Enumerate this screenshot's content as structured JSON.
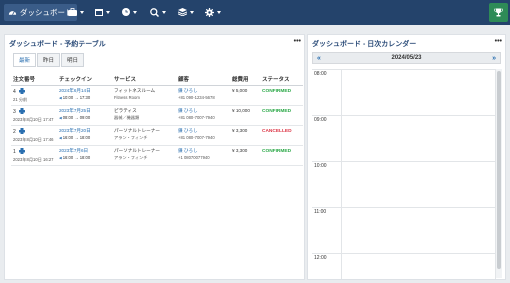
{
  "nav": {
    "brand": "ダッシュボード",
    "items": [
      {
        "icon": "briefcase-icon"
      },
      {
        "icon": "calendar-icon"
      },
      {
        "icon": "clock-icon"
      },
      {
        "icon": "zoom-icon"
      },
      {
        "icon": "layers-icon"
      },
      {
        "icon": "gear-icon"
      }
    ],
    "trophy_icon": "trophy-icon"
  },
  "left_panel": {
    "title": "ダッシュボード - 予約テーブル",
    "menu": "•••",
    "tabs": [
      {
        "label": "最新",
        "active": true
      },
      {
        "label": "昨日",
        "active": false
      },
      {
        "label": "明日",
        "active": false
      }
    ],
    "columns": [
      "注文番号",
      "チェックイン",
      "サービス",
      "顧客",
      "総費用",
      "ステータス"
    ],
    "rows": [
      {
        "id": "4",
        "sub": "21 分前",
        "date": "2024年6月14日",
        "time": "10:00 → 17:30",
        "service": "フィットネスルーム",
        "service_sub": "Fitness Room",
        "customer": "鎌 ひろし",
        "phone": "+81 090-1234-5678",
        "total": "¥ 5,000",
        "status": "CONFIRMED",
        "status_color": "green"
      },
      {
        "id": "3",
        "sub": "2023年8月10日 17:47",
        "date": "2023年7月25日",
        "time": "08:00 → 09:00",
        "service": "ピラティス",
        "service_sub": "器械／機器類",
        "customer": "鎌 ひろし",
        "phone": "+81 080-7007-7940",
        "total": "¥ 10,000",
        "status": "CONFIRMED",
        "status_color": "green"
      },
      {
        "id": "2",
        "sub": "2023年8月10日 17:46",
        "date": "2023年7月20日",
        "time": "16:00 → 18:00",
        "service": "パーソナルトレーナー",
        "service_sub": "アラン・フィンチ",
        "customer": "鎌 ひろし",
        "phone": "+81 080-7007-7940",
        "total": "¥ 3,300",
        "status": "CANCELLED",
        "status_color": "red"
      },
      {
        "id": "1",
        "sub": "2023年8月10日 16:27",
        "date": "2023年7月6日",
        "time": "16:00 → 18:00",
        "service": "パーソナルトレーナー",
        "service_sub": "アラン・フィンチ",
        "customer": "鎌 ひろし",
        "phone": "+1 08070077940",
        "total": "¥ 3,300",
        "status": "CONFIRMED",
        "status_color": "green"
      }
    ]
  },
  "right_panel": {
    "title": "ダッシュボード - 日次カレンダー",
    "menu": "•••",
    "prev": "«",
    "next": "»",
    "date": "2024/05/23",
    "hours": [
      "08:00",
      "09:00",
      "10:00",
      "11:00",
      "12:00"
    ]
  },
  "colors": {
    "topbar": "#24436b",
    "accent": "#2a6fb0",
    "confirmed": "#28a745",
    "cancelled": "#dc3545"
  }
}
